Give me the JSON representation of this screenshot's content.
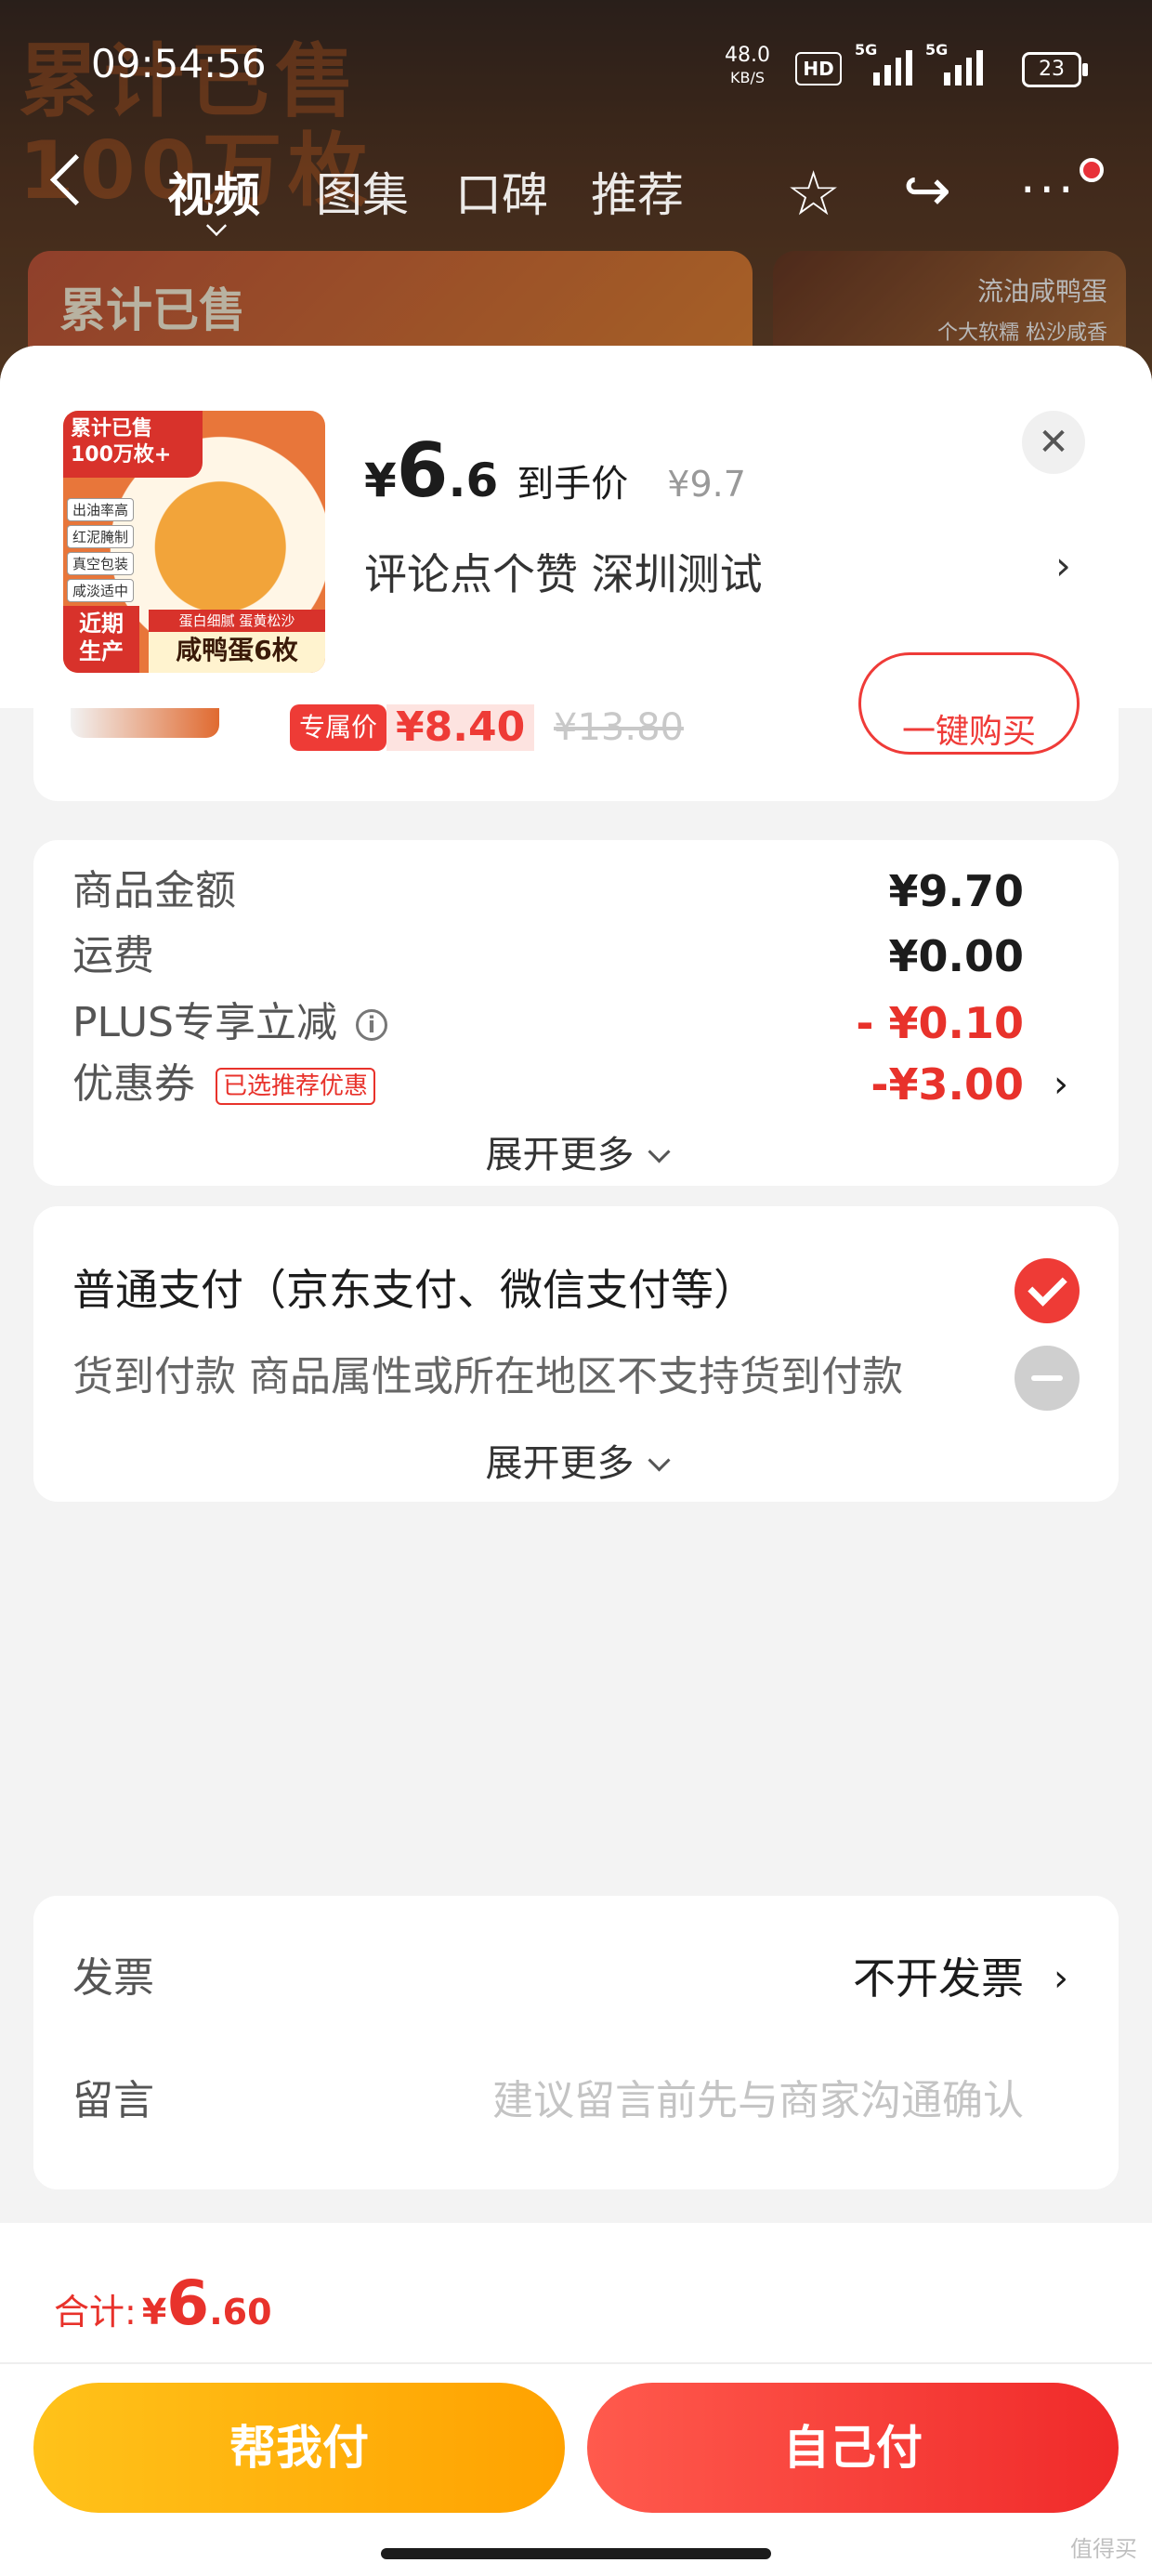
{
  "status_bar": {
    "time": "09:54:56",
    "net_speed": "48.0",
    "net_unit": "KB/S",
    "hd": "HD",
    "signal1": "5G",
    "signal2": "5G",
    "battery": "23"
  },
  "nav": {
    "tabs": [
      "视频",
      "图集",
      "口碑",
      "推荐"
    ],
    "active_tab": "视频"
  },
  "background": {
    "promo": "累计已售",
    "promo2": "100万枚",
    "thumb1": "累计已售",
    "thumb2_line1": "流油咸鸭蛋",
    "thumb2_line2": "个大软糯 松沙咸香"
  },
  "product": {
    "image_badge": "累计已售\n100万枚+",
    "image_tags": [
      "出油率高",
      "红泥腌制",
      "真空包装",
      "咸淡适中"
    ],
    "image_corner": "近期\n生产",
    "image_bar_top": "蛋白细腻 蛋黄松沙",
    "image_bar_main": "咸鸭蛋6枚",
    "price_symbol": "¥",
    "price_int": "6",
    "price_dec": ".6",
    "price_label": "到手价",
    "original_price": "¥9.7",
    "spec": "评论点个赞  深圳测试"
  },
  "peek": {
    "tag": "专属价",
    "price": "¥8.40",
    "original": "¥13.80",
    "buy_label": "一键购买"
  },
  "amounts": {
    "goods_label": "商品金额",
    "goods_value": "¥9.70",
    "shipping_label": "运费",
    "shipping_value": "¥0.00",
    "plus_label": "PLUS专享立减",
    "plus_value": "- ¥0.10",
    "coupon_label": "优惠券",
    "coupon_tag": "已选推荐优惠",
    "coupon_value": "-¥3.00",
    "expand": "展开更多"
  },
  "payment": {
    "normal": "普通支付（京东支付、微信支付等）",
    "cod": "货到付款 商品属性或所在地区不支持货到付款",
    "expand": "展开更多"
  },
  "extra": {
    "invoice_label": "发票",
    "invoice_value": "不开发票",
    "message_label": "留言",
    "message_placeholder": "建议留言前先与商家沟通确认"
  },
  "footer": {
    "total_label": "合计:",
    "total_symbol": "¥",
    "total_int": "6",
    "total_dec": ".60",
    "help_pay": "帮我付",
    "self_pay": "自己付"
  },
  "watermark": "值得买",
  "colors": {
    "accent_red": "#e8322b",
    "accent_yellow": "#ffb400"
  }
}
